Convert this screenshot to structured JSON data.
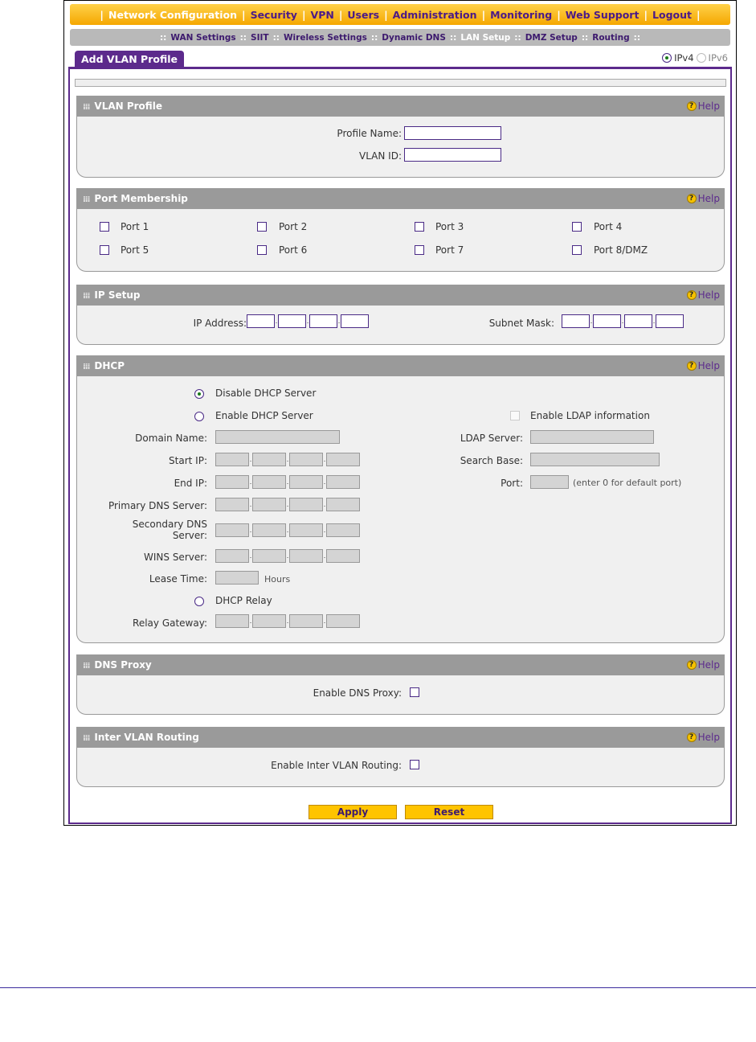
{
  "top_nav": {
    "items": [
      {
        "label": "Network Configuration",
        "active": true
      },
      {
        "label": "Security",
        "active": false
      },
      {
        "label": "VPN",
        "active": false
      },
      {
        "label": "Users",
        "active": false
      },
      {
        "label": "Administration",
        "active": false
      },
      {
        "label": "Monitoring",
        "active": false
      },
      {
        "label": "Web Support",
        "active": false
      },
      {
        "label": "Logout",
        "active": false
      }
    ]
  },
  "sub_nav": {
    "items": [
      {
        "label": "WAN Settings",
        "active": false
      },
      {
        "label": "SIIT",
        "active": false
      },
      {
        "label": "Wireless Settings",
        "active": false
      },
      {
        "label": "Dynamic DNS",
        "active": false
      },
      {
        "label": "LAN Setup",
        "active": true
      },
      {
        "label": "DMZ Setup",
        "active": false
      },
      {
        "label": "Routing",
        "active": false
      }
    ]
  },
  "tab": {
    "label": "Add VLAN Profile"
  },
  "ip_version": {
    "ipv4": "IPv4",
    "ipv6": "IPv6",
    "selected": "IPv4"
  },
  "help_label": "Help",
  "vlan_profile": {
    "title": "VLAN Profile",
    "profile_name_label": "Profile Name:",
    "vlan_id_label": "VLAN ID:"
  },
  "port_membership": {
    "title": "Port Membership",
    "ports": [
      "Port 1",
      "Port 2",
      "Port 3",
      "Port 4",
      "Port 5",
      "Port 6",
      "Port 7",
      "Port 8/DMZ"
    ]
  },
  "ip_setup": {
    "title": "IP Setup",
    "ip_address_label": "IP Address:",
    "subnet_mask_label": "Subnet Mask:"
  },
  "dhcp": {
    "title": "DHCP",
    "disable_label": "Disable DHCP Server",
    "enable_label": "Enable DHCP Server",
    "relay_label": "DHCP Relay",
    "selected_mode": "Disable DHCP Server",
    "domain_name_label": "Domain Name:",
    "start_ip_label": "Start IP:",
    "end_ip_label": "End IP:",
    "primary_dns_label": "Primary DNS Server:",
    "secondary_dns_label_1": "Secondary DNS",
    "secondary_dns_label_2": "Server:",
    "wins_label": "WINS Server:",
    "lease_time_label": "Lease Time:",
    "lease_unit": "Hours",
    "relay_gateway_label": "Relay Gateway:",
    "ldap_enable_label": "Enable LDAP information",
    "ldap_server_label": "LDAP Server:",
    "search_base_label": "Search Base:",
    "port_label": "Port:",
    "port_hint": "(enter 0 for default port)"
  },
  "dns_proxy": {
    "title": "DNS Proxy",
    "enable_label": "Enable DNS Proxy:"
  },
  "inter_vlan": {
    "title": "Inter VLAN Routing",
    "enable_label": "Enable Inter VLAN Routing:"
  },
  "buttons": {
    "apply": "Apply",
    "reset": "Reset"
  }
}
